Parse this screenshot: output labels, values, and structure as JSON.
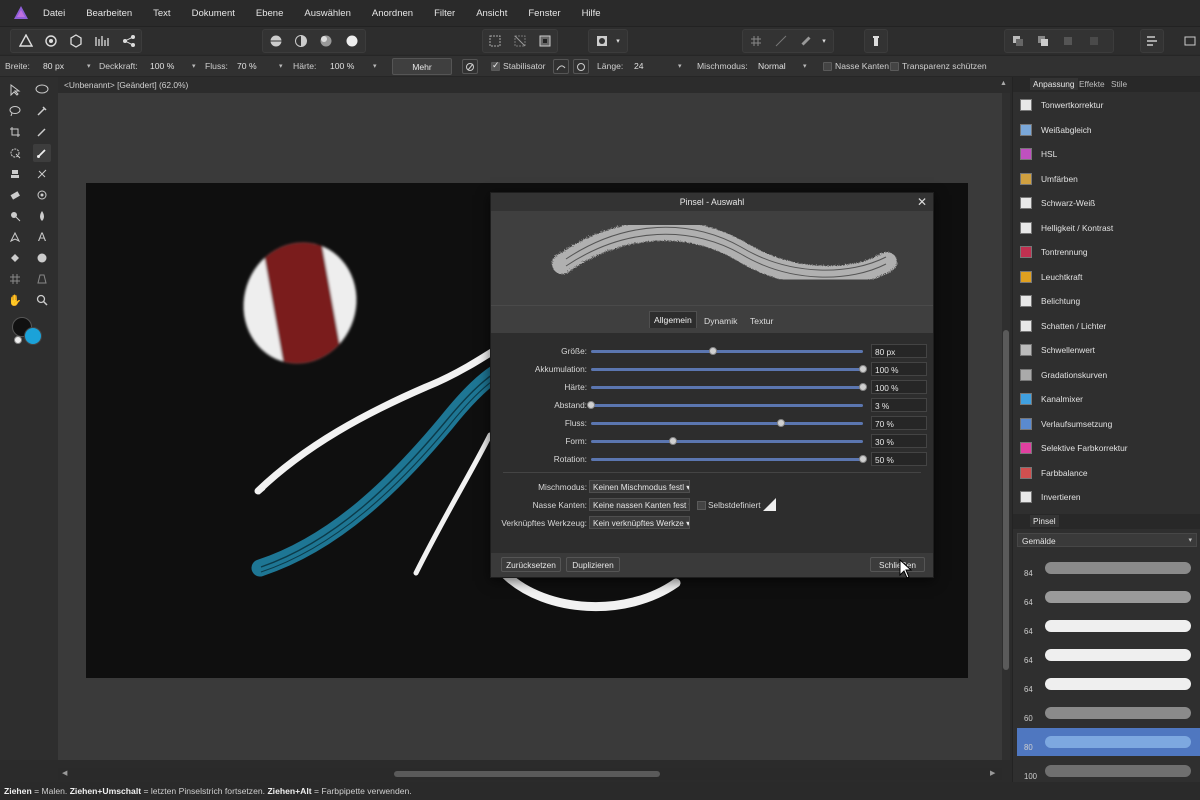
{
  "menubar": {
    "items": [
      "Datei",
      "Bearbeiten",
      "Text",
      "Dokument",
      "Ebene",
      "Auswählen",
      "Anordnen",
      "Filter",
      "Ansicht",
      "Fenster",
      "Hilfe"
    ],
    "logo_icon": "affinity-photo-logo-icon"
  },
  "context_bar": {
    "breite_label": "Breite:",
    "breite_value": "80 px",
    "deckkraft_label": "Deckkraft:",
    "deckkraft_value": "100 %",
    "fluss_label": "Fluss:",
    "fluss_value": "70 %",
    "haerte_label": "Härte:",
    "haerte_value": "100 %",
    "mehr_label": "Mehr",
    "stabilisator_label": "Stabilisator",
    "stabilisator_checked": true,
    "laenge_label": "Länge:",
    "laenge_value": "24",
    "mischmodus_label": "Mischmodus:",
    "mischmodus_value": "Normal",
    "nasse_kanten_label": "Nasse Kanten",
    "nasse_kanten_checked": false,
    "transparenz_label": "Transparenz schützen",
    "transparenz_checked": false
  },
  "document": {
    "title": "<Unbenannt> [Geändert] (62.0%)"
  },
  "right_panel": {
    "tabs": [
      "Anpassung",
      "Effekte",
      "Stile"
    ],
    "active_tab": "Anpassung",
    "adjustments": [
      {
        "label": "Tonwertkorrektur",
        "icon": "levels-icon",
        "color": "#e8e8e8"
      },
      {
        "label": "Weißabgleich",
        "icon": "white-balance-icon",
        "color": "#7aa7d8"
      },
      {
        "label": "HSL",
        "icon": "hsl-icon",
        "color": "#c050c0"
      },
      {
        "label": "Umfärben",
        "icon": "recolor-icon",
        "color": "#d0a040"
      },
      {
        "label": "Schwarz-Weiß",
        "icon": "black-white-icon",
        "color": "#e8e8e8"
      },
      {
        "label": "Helligkeit / Kontrast",
        "icon": "brightness-contrast-icon",
        "color": "#e8e8e8"
      },
      {
        "label": "Tontrennung",
        "icon": "posterize-icon",
        "color": "#c03050"
      },
      {
        "label": "Leuchtkraft",
        "icon": "vibrance-icon",
        "color": "#e0a020"
      },
      {
        "label": "Belichtung",
        "icon": "exposure-icon",
        "color": "#e8e8e8"
      },
      {
        "label": "Schatten / Lichter",
        "icon": "shadows-highlights-icon",
        "color": "#e8e8e8"
      },
      {
        "label": "Schwellenwert",
        "icon": "threshold-icon",
        "color": "#bbbbbb"
      },
      {
        "label": "Gradationskurven",
        "icon": "curves-icon",
        "color": "#aaaaaa"
      },
      {
        "label": "Kanalmixer",
        "icon": "channel-mixer-icon",
        "color": "#40a0e0"
      },
      {
        "label": "Verlaufsumsetzung",
        "icon": "gradient-map-icon",
        "color": "#5a8ad0"
      },
      {
        "label": "Selektive Farbkorrektur",
        "icon": "selective-color-icon",
        "color": "#e040a0"
      },
      {
        "label": "Farbbalance",
        "icon": "color-balance-icon",
        "color": "#d05050"
      },
      {
        "label": "Invertieren",
        "icon": "invert-icon",
        "color": "#e8e8e8"
      }
    ],
    "brushes_tab": "Pinsel",
    "brush_category": "Gemälde",
    "brushes": [
      {
        "size": "84"
      },
      {
        "size": "64"
      },
      {
        "size": "64"
      },
      {
        "size": "64"
      },
      {
        "size": "64"
      },
      {
        "size": "60"
      },
      {
        "size": "80"
      },
      {
        "size": "100"
      }
    ]
  },
  "dialog": {
    "title": "Pinsel - Auswahl",
    "tabs": [
      "Allgemein",
      "Dynamik",
      "Textur"
    ],
    "active_tab": "Allgemein",
    "params": [
      {
        "label": "Größe:",
        "value": "80 px",
        "fraction": 0.45
      },
      {
        "label": "Akkumulation:",
        "value": "100 %",
        "fraction": 1.0
      },
      {
        "label": "Härte:",
        "value": "100 %",
        "fraction": 1.0
      },
      {
        "label": "Abstand:",
        "value": "3 %",
        "fraction": 0.0
      },
      {
        "label": "Fluss:",
        "value": "70 %",
        "fraction": 0.7
      },
      {
        "label": "Form:",
        "value": "30 %",
        "fraction": 0.3
      },
      {
        "label": "Rotation:",
        "value": "50 %",
        "fraction": 1.0
      }
    ],
    "mischmodus_label": "Mischmodus:",
    "mischmodus_value": "Keinen Mischmodus festl",
    "nasse_kanten_label": "Nasse Kanten:",
    "nasse_kanten_value": "Keine nassen Kanten fest",
    "selbstdefiniert_label": "Selbstdefiniert",
    "werkzeug_label": "Verknüpftes Werkzeug:",
    "werkzeug_value": "Kein verknüpftes Werkze",
    "reset_label": "Zurücksetzen",
    "duplicate_label": "Duplizieren",
    "close_label": "Schließen"
  },
  "status": {
    "k1": "Ziehen",
    "t1": " = Malen. ",
    "k2": "Ziehen+Umschalt",
    "t2": " = letzten Pinselstrich fortsetzen. ",
    "k3": "Ziehen+Alt",
    "t3": " = Farbpipette verwenden."
  },
  "colors": {
    "accent": "#5b76b0",
    "primary_color": "#111111",
    "secondary_color": "#1ba2d9",
    "red_paint": "#7a1e1e",
    "teal_paint": "#1f7fa0"
  }
}
